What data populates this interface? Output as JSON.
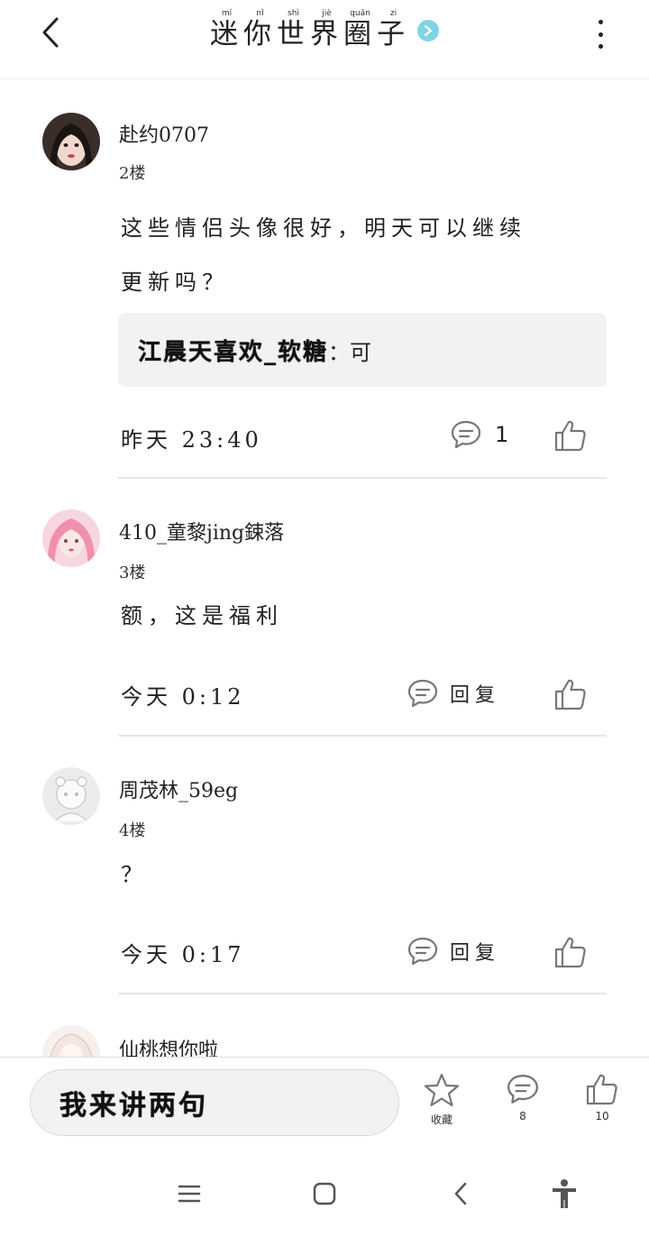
{
  "header": {
    "title": "迷你世界圈子",
    "title_pinyin": [
      "mí",
      "nǐ",
      "shì",
      "jiè",
      "quān",
      "zi"
    ],
    "accent_color": "#7fd3e3"
  },
  "comments": [
    {
      "username": "赴约0707",
      "floor": "2楼",
      "text_line1": "这些情侣头像很好，明天可以继续",
      "text_line2": "更新吗？",
      "reply_name": "江晨天喜欢_软糖",
      "reply_text": "：可",
      "time": "昨天 23:40",
      "comment_count": "1",
      "avatar_icon": "avatar-girl-dark-hair"
    },
    {
      "username": "410_童黎jing鋉落",
      "floor": "3楼",
      "text_line1": "额，这是福利",
      "time": "今天 0:12",
      "reply_label": "回复",
      "avatar_icon": "avatar-pink-hair"
    },
    {
      "username": "周茂林_59eg",
      "floor": "4楼",
      "text_line1": "？",
      "time": "今天 0:17",
      "reply_label": "回复",
      "avatar_icon": "avatar-default-bear"
    },
    {
      "username": "仙桃想你啦",
      "avatar_icon": "avatar-white-hair"
    }
  ],
  "bottom_bar": {
    "input_placeholder": "我来讲两句",
    "favorite_label": "收藏",
    "comment_count": "8",
    "like_count": "10"
  },
  "icons": {
    "back": "chevron-left-icon",
    "more": "more-vertical-icon",
    "comment": "comment-bubble-icon",
    "like": "thumbs-up-icon",
    "favorite": "star-icon",
    "nav_menu": "menu-icon",
    "nav_home": "home-square-icon",
    "nav_back": "back-icon",
    "nav_accessibility": "accessibility-icon"
  }
}
